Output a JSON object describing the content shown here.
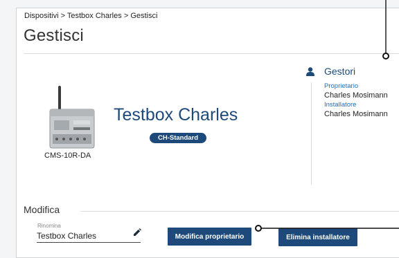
{
  "breadcrumb": {
    "items": [
      "Dispositivi",
      "Testbox Charles",
      "Gestisci"
    ],
    "separator": ">"
  },
  "page": {
    "title": "Gestisci"
  },
  "device": {
    "model": "CMS-10R-DA",
    "name": "Testbox Charles",
    "plan_badge": "CH-Standard"
  },
  "gestori": {
    "title": "Gestori",
    "icon": "user-icon",
    "entries": [
      {
        "role": "Proprietario",
        "name": "Charles Mosimann"
      },
      {
        "role": "Installatore",
        "name": "Charles Mosimann"
      }
    ]
  },
  "modifica": {
    "title": "Modifica",
    "rename_label": "Rinomina",
    "rename_value": "Testbox Charles",
    "edit_icon": "pencil-icon",
    "owner_button": "Modifica proprietario",
    "installer_button": "Elimina installatore"
  },
  "colors": {
    "accent": "#1d4a7a",
    "link": "#1a6fc2"
  }
}
